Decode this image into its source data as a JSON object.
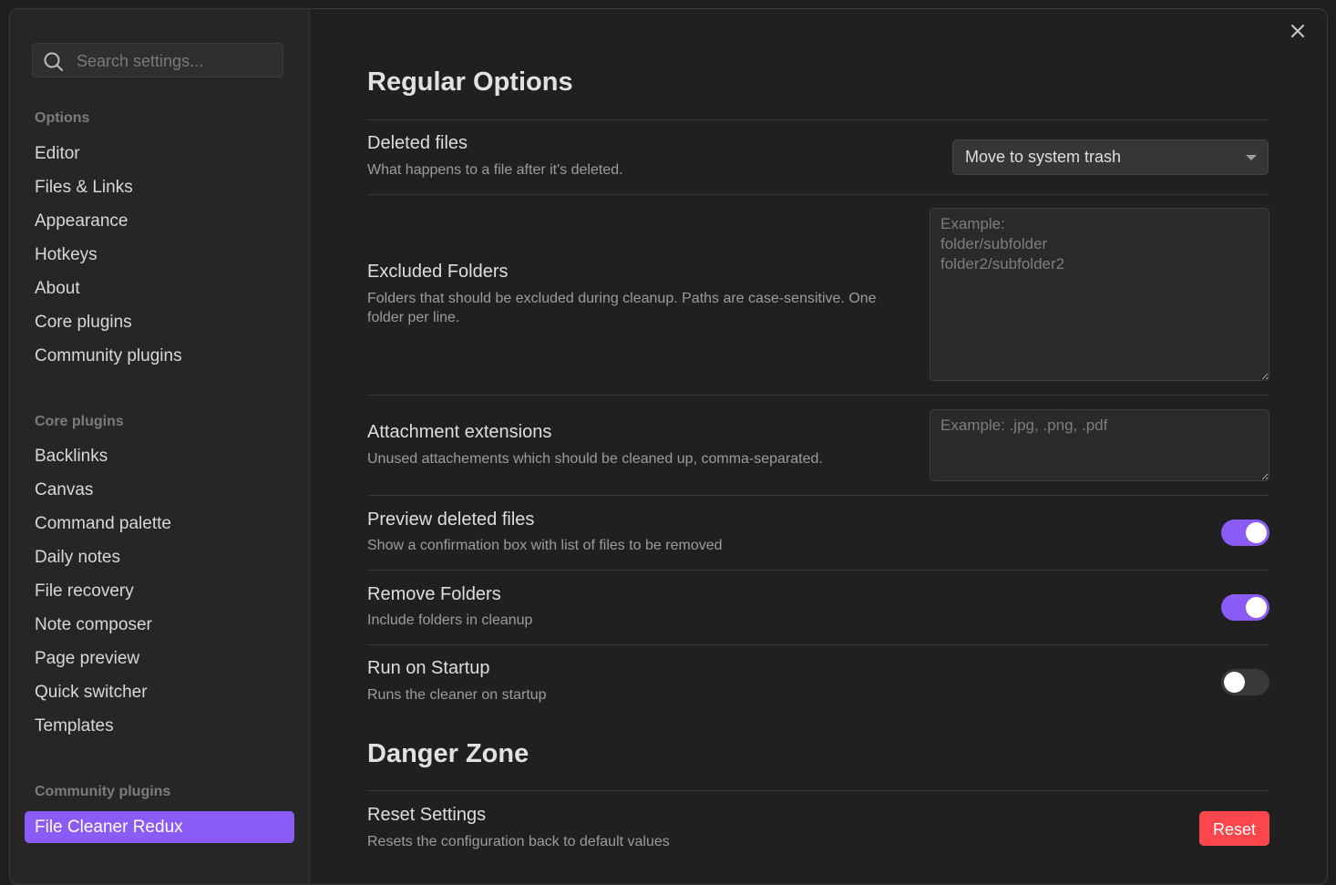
{
  "search": {
    "placeholder": "Search settings..."
  },
  "sidebar": {
    "options_title": "Options",
    "options": [
      "Editor",
      "Files & Links",
      "Appearance",
      "Hotkeys",
      "About",
      "Core plugins",
      "Community plugins"
    ],
    "core_title": "Core plugins",
    "core": [
      "Backlinks",
      "Canvas",
      "Command palette",
      "Daily notes",
      "File recovery",
      "Note composer",
      "Page preview",
      "Quick switcher",
      "Templates"
    ],
    "community_title": "Community plugins",
    "community": [
      "File Cleaner Redux"
    ]
  },
  "main": {
    "regular_heading": "Regular Options",
    "danger_heading": "Danger Zone",
    "deleted_files": {
      "name": "Deleted files",
      "desc": "What happens to a file after it's deleted.",
      "value": "Move to system trash"
    },
    "excluded_folders": {
      "name": "Excluded Folders",
      "desc": "Folders that should be excluded during cleanup. Paths are case-sensitive. One folder per line.",
      "placeholder": "Example:\nfolder/subfolder\nfolder2/subfolder2"
    },
    "attachment_extensions": {
      "name": "Attachment extensions",
      "desc": "Unused attachements which should be cleaned up, comma-separated.",
      "placeholder": "Example: .jpg, .png, .pdf"
    },
    "preview_deleted": {
      "name": "Preview deleted files",
      "desc": "Show a confirmation box with list of files to be removed",
      "enabled": true
    },
    "remove_folders": {
      "name": "Remove Folders",
      "desc": "Include folders in cleanup",
      "enabled": true
    },
    "run_on_startup": {
      "name": "Run on Startup",
      "desc": "Runs the cleaner on startup",
      "enabled": false
    },
    "reset_settings": {
      "name": "Reset Settings",
      "desc": "Resets the configuration back to default values",
      "button": "Reset"
    }
  },
  "colors": {
    "accent": "#8a5cf5",
    "danger": "#fb464c"
  }
}
